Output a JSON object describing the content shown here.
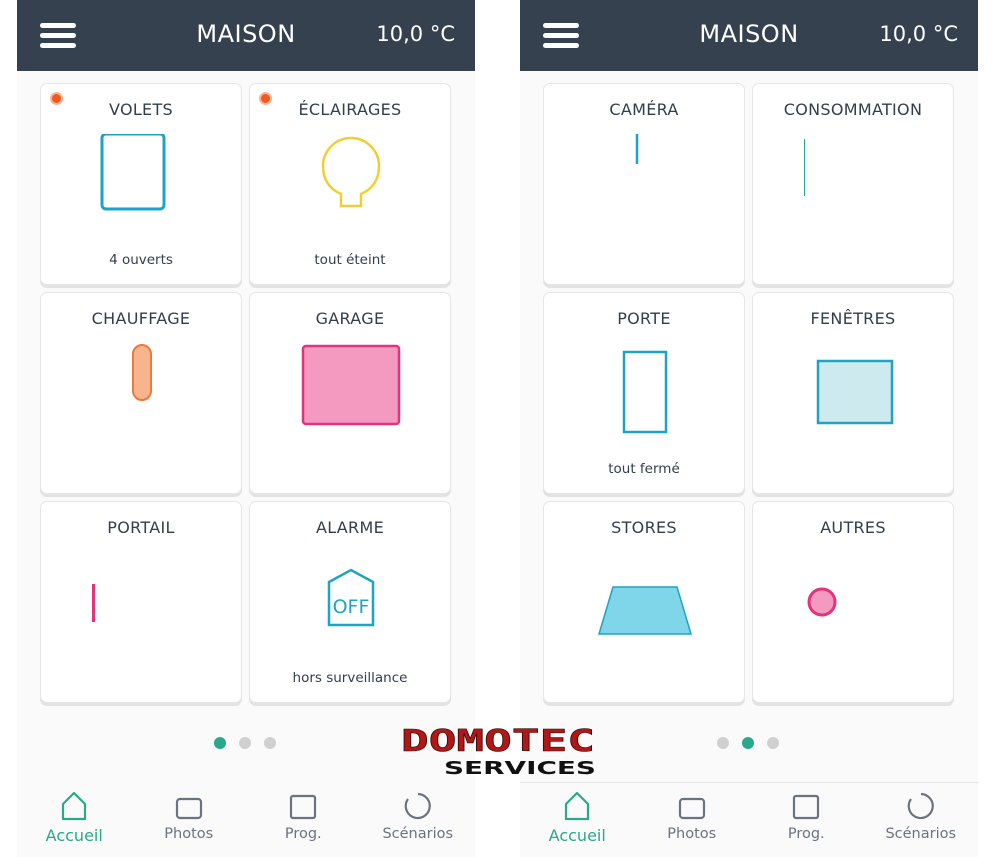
{
  "colors": {
    "header": "#36414f",
    "accent": "#2aa889",
    "indicator": "#f05a22"
  },
  "logo": {
    "text_top": "DOMOTEC",
    "text_bottom": "SERVICES"
  },
  "screens": [
    {
      "header": {
        "title": "MAISON",
        "temperature": "10,0 °C",
        "menu_icon": "hamburger-icon"
      },
      "active_page": 0,
      "pages": 3,
      "cards": [
        {
          "label": "VOLETS",
          "status": "4 ouverts",
          "icon": "shutter",
          "indicator": true
        },
        {
          "label": "ÉCLAIRAGES",
          "status": "tout éteint",
          "icon": "bulb",
          "indicator": true
        },
        {
          "label": "CHAUFFAGE",
          "status": "",
          "icon": "thermometer"
        },
        {
          "label": "GARAGE",
          "status": "",
          "icon": "garage"
        },
        {
          "label": "PORTAIL",
          "status": "",
          "icon": "gate"
        },
        {
          "label": "ALARME",
          "status": "hors surveillance",
          "icon": "alarm",
          "icon_text": "OFF"
        }
      ]
    },
    {
      "header": {
        "title": "MAISON",
        "temperature": "10,0 °C",
        "menu_icon": "hamburger-icon"
      },
      "active_page": 1,
      "pages": 3,
      "cards": [
        {
          "label": "CAMÉRA",
          "status": "",
          "icon": "camera"
        },
        {
          "label": "CONSOMMATION",
          "status": "",
          "icon": "chart"
        },
        {
          "label": "PORTE",
          "status": "tout fermé",
          "icon": "door"
        },
        {
          "label": "FENÊTRES",
          "status": "",
          "icon": "window"
        },
        {
          "label": "STORES",
          "status": "",
          "icon": "awning"
        },
        {
          "label": "AUTRES",
          "status": "",
          "icon": "more"
        }
      ]
    }
  ],
  "nav": [
    {
      "label": "Accueil",
      "icon": "home",
      "active": true
    },
    {
      "label": "Photos",
      "icon": "camera"
    },
    {
      "label": "Prog.",
      "icon": "calendar"
    },
    {
      "label": "Scénarios",
      "icon": "play"
    }
  ]
}
